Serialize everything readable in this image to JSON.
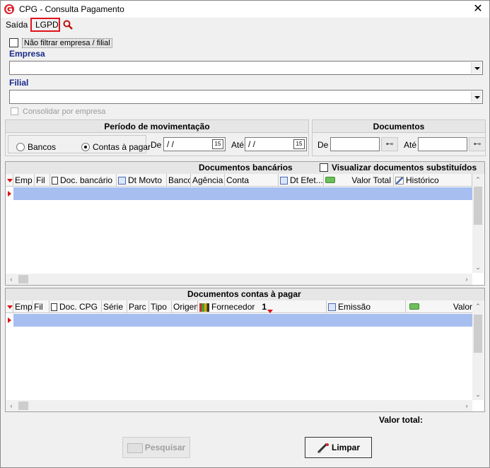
{
  "window": {
    "title": "CPG - Consulta Pagamento",
    "close_glyph": "✕"
  },
  "menu": {
    "saida": "Saída",
    "lgpd": "LGPD",
    "search_icon": "magnifier-icon"
  },
  "filters": {
    "no_filter_label": "Não filtrar empresa / filial",
    "empresa_label": "Empresa",
    "empresa_value": "",
    "filial_label": "Filial",
    "filial_value": "",
    "consolidar_label": "Consolidar por empresa"
  },
  "periodo": {
    "title": "Período de movimentação",
    "radio_bancos": "Bancos",
    "radio_contas": "Contas à pagar",
    "selected": "contas",
    "de_label": "De",
    "de_value": "/ /",
    "ate_label": "Até",
    "ate_value": "/ /",
    "cal_glyph": "15"
  },
  "documentos": {
    "title": "Documentos",
    "de_label": "De",
    "de_value": "",
    "ate_label": "Até",
    "ate_value": ""
  },
  "bancarios": {
    "title": "Documentos bancários",
    "checkbox_label": "Visualizar documentos substituídos",
    "columns": [
      "Emp",
      "Fil",
      "Doc. bancário",
      "Dt Movto",
      "Banco",
      "Agência",
      "Conta",
      "Dt Efet...",
      "Valor Total",
      "Histórico"
    ]
  },
  "contas": {
    "title": "Documentos contas à pagar",
    "sort_marker": "1",
    "columns": [
      "Emp",
      "Fil",
      "Doc. CPG",
      "Série",
      "Parc",
      "Tipo",
      "Origem",
      "Fornecedor",
      "Emissão",
      "Valor"
    ]
  },
  "footer": {
    "valor_total_label": "Valor total:",
    "valor_total_value": ""
  },
  "buttons": {
    "pesquisar": "Pesquisar",
    "limpar": "Limpar"
  },
  "colors": {
    "accent_red": "#e0141b",
    "selection": "#a6bff0",
    "label_blue": "#1a2b8c"
  }
}
